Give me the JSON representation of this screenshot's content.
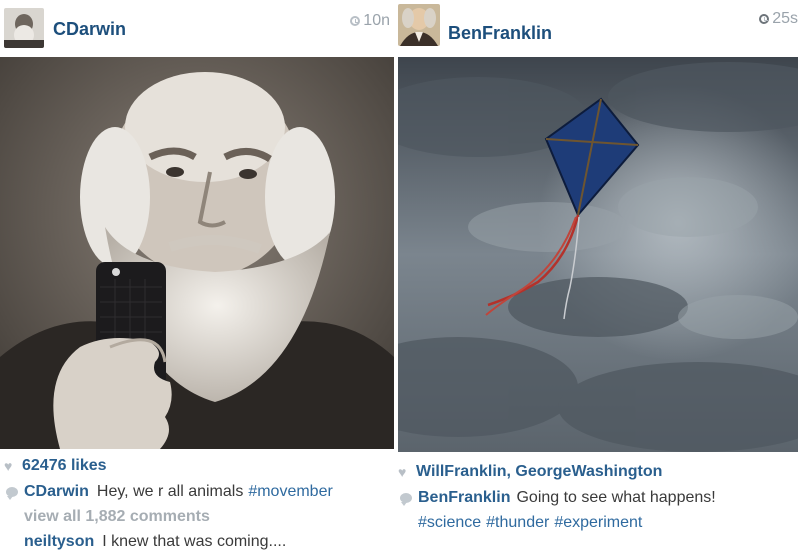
{
  "posts": [
    {
      "username": "CDarwin",
      "time": "10n",
      "likes": "62476 likes",
      "caption": {
        "user": "CDarwin",
        "text": "Hey, we r all animals",
        "tag": "#movember"
      },
      "view_all": "view all 1,882 comments",
      "comment": {
        "user": "neiltyson",
        "text": "I knew that was coming...."
      }
    },
    {
      "username": "BenFranklin",
      "time": "25s",
      "likers": "WillFranklin, GeorgeWashington",
      "caption": {
        "user": "BenFranklin",
        "text": "Going to see what happens!",
        "tags": [
          "#science",
          "#thunder",
          "#experiment"
        ]
      }
    }
  ],
  "colors": {
    "username": "#1d4f7c",
    "hashtag": "#2f6a9f",
    "muted": "#a6adb3"
  }
}
